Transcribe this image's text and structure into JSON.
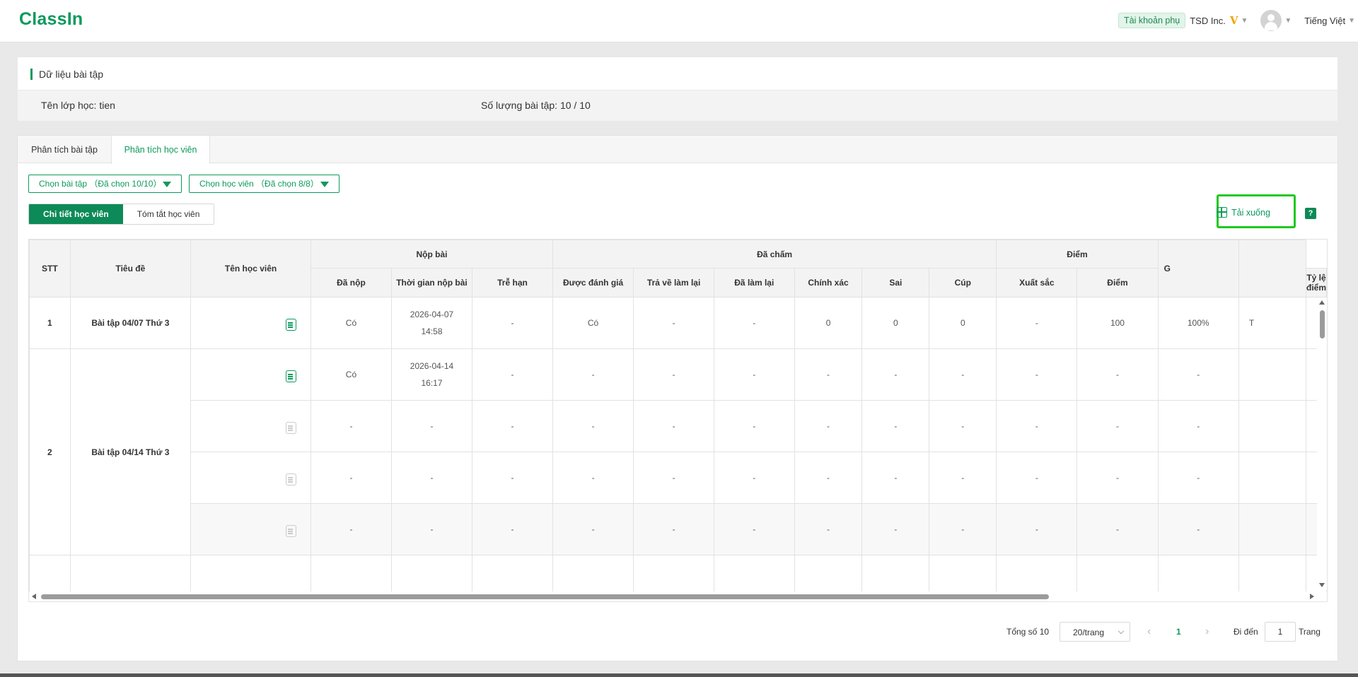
{
  "header": {
    "logo": "ClassIn",
    "sub_account": "Tài khoản phụ",
    "org_name": "TSD Inc.",
    "vip_mark": "V",
    "language": "Tiếng Việt"
  },
  "info": {
    "title": "Dữ liệu bài tập",
    "class_name": "Tên lớp học: tien",
    "assignment_count": "Số lượng bài tập: 10 / 10"
  },
  "tabs": [
    {
      "label": "Phân tích bài tập",
      "active": false
    },
    {
      "label": "Phân tích học viên",
      "active": true
    }
  ],
  "filters": {
    "assignments": "Chọn bài tập （Đã chọn 10/10）",
    "students": "Chọn học viên （Đã chọn 8/8）"
  },
  "view_toggle": {
    "detail": "Chi tiết học viên",
    "summary": "Tóm tắt học viên"
  },
  "download": {
    "label": "Tải xuống",
    "help": "?"
  },
  "table": {
    "headers": {
      "stt": "STT",
      "title": "Tiêu đề",
      "student": "Tên học viên",
      "group_submit": "Nộp bài",
      "group_graded": "Đã chấm",
      "group_score": "Điểm",
      "next_col_partial": "G",
      "submitted": "Đã nộp",
      "submit_time": "Thời gian nộp bài",
      "late": "Trễ hạn",
      "evaluated": "Được đánh giá",
      "returned": "Trả về làm lại",
      "redone": "Đã làm lại",
      "correct": "Chính xác",
      "wrong": "Sai",
      "cup": "Cúp",
      "excellent": "Xuất sắc",
      "score": "Điểm",
      "score_rate": "Tỷ lệ điểm"
    },
    "groups": [
      {
        "stt": "1",
        "title": "Bài tập 04/07 Thứ 3",
        "rows": [
          {
            "submitted": "Có",
            "date": "2026-04-07",
            "time": "14:58",
            "late": "-",
            "evaluated": "Có",
            "returned": "-",
            "redone": "-",
            "correct": "0",
            "wrong": "0",
            "cup": "0",
            "excellent": "-",
            "score": "100",
            "rate": "100%",
            "next": "T"
          }
        ]
      },
      {
        "stt": "2",
        "title": "Bài tập 04/14 Thứ 3",
        "rows": [
          {
            "submitted": "Có",
            "date": "2026-04-14",
            "time": "16:17",
            "late": "-",
            "evaluated": "-",
            "returned": "-",
            "redone": "-",
            "correct": "-",
            "wrong": "-",
            "cup": "-",
            "excellent": "-",
            "score": "-",
            "rate": "-",
            "next": ""
          },
          {
            "submitted": "-",
            "date": "-",
            "time": "",
            "late": "-",
            "evaluated": "-",
            "returned": "-",
            "redone": "-",
            "correct": "-",
            "wrong": "-",
            "cup": "-",
            "excellent": "-",
            "score": "-",
            "rate": "-",
            "next": ""
          },
          {
            "submitted": "-",
            "date": "-",
            "time": "",
            "late": "-",
            "evaluated": "-",
            "returned": "-",
            "redone": "-",
            "correct": "-",
            "wrong": "-",
            "cup": "-",
            "excellent": "-",
            "score": "-",
            "rate": "-",
            "next": ""
          },
          {
            "submitted": "-",
            "date": "-",
            "time": "",
            "late": "-",
            "evaluated": "-",
            "returned": "-",
            "redone": "-",
            "correct": "-",
            "wrong": "-",
            "cup": "-",
            "excellent": "-",
            "score": "-",
            "rate": "-",
            "next": ""
          }
        ]
      }
    ]
  },
  "pagination": {
    "total": "Tổng số 10",
    "page_size": "20/trang",
    "current_page": "1",
    "goto_label": "Đi đến",
    "goto_value": "1",
    "page_suffix": "Trang"
  },
  "colors": {
    "brand": "#0c9a5d",
    "highlight": "#1ec91e"
  }
}
